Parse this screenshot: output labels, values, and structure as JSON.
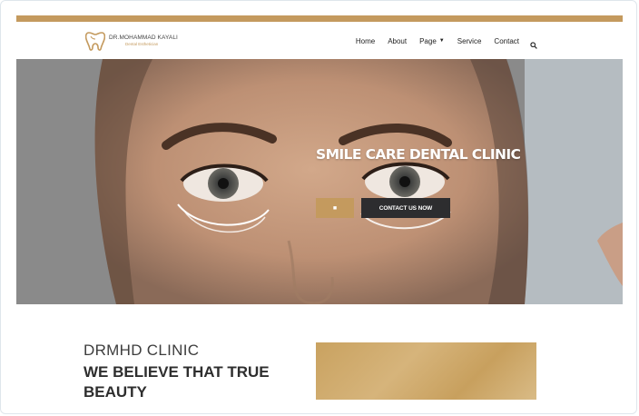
{
  "brand": {
    "name": "DR.MOHAMMAD KAYALI",
    "subtitle": "Dental Esthetician",
    "accent_color": "#c49a5e",
    "logo_icon": "tooth-icon"
  },
  "nav": {
    "items": [
      {
        "label": "Home"
      },
      {
        "label": "About"
      },
      {
        "label": "Page",
        "has_dropdown": true
      },
      {
        "label": "Service"
      },
      {
        "label": "Contact"
      }
    ],
    "search_icon": "search-icon"
  },
  "hero": {
    "title": "SMILE CARE DENTAL CLINIC",
    "primary_button": "■",
    "secondary_button": "CONTACT US NOW"
  },
  "about": {
    "kicker": "DRMHD CLINIC",
    "title": "WE BELIEVE THAT TRUE BEAUTY"
  }
}
